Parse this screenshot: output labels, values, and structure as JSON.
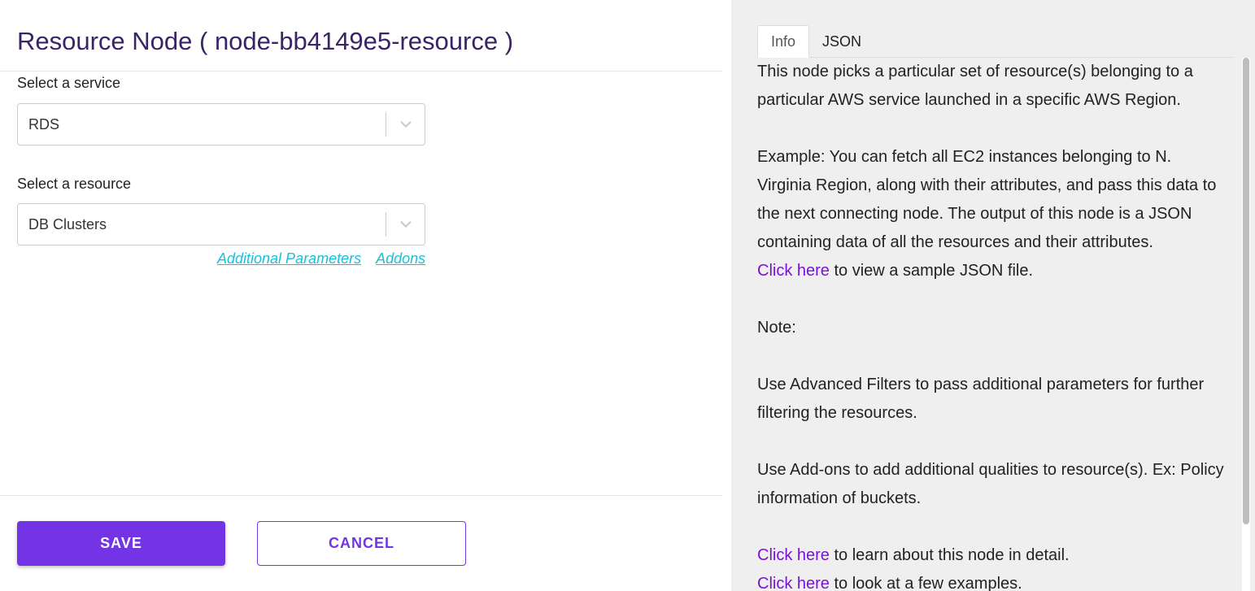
{
  "header": {
    "title": "Resource Node ( node-bb4149e5-resource )"
  },
  "form": {
    "service": {
      "label": "Select a service",
      "value": "RDS"
    },
    "resource": {
      "label": "Select a resource",
      "value": "DB Clusters"
    },
    "links": {
      "additional_parameters": "Additional Parameters",
      "addons": "Addons"
    }
  },
  "actions": {
    "save_label": "SAVE",
    "cancel_label": "CANCEL"
  },
  "panel": {
    "tabs": [
      {
        "label": "Info",
        "active": true
      },
      {
        "label": "JSON",
        "active": false
      }
    ],
    "info": {
      "intro": "This node picks a particular set of resource(s) belonging to a particular AWS service launched in a specific AWS Region.",
      "example": "Example: You can fetch all EC2 instances belonging to N. Virginia Region, along with their attributes, and pass this data to the next connecting node. The output of this node is a JSON containing data of all the resources and their attributes.",
      "sample_link": "Click here",
      "sample_text": " to view a sample JSON file.",
      "note": "Note:",
      "filters": "Use Advanced Filters to pass additional parameters for further filtering the resources.",
      "addons": "Use Add-ons to add additional qualities to resource(s). Ex: Policy information of buckets.",
      "learn_link": "Click here",
      "learn_text": " to learn about this node in detail.",
      "examples_link": "Click here",
      "examples_text": " to look at a few examples."
    }
  },
  "colors": {
    "title": "#3a2466",
    "accent": "#7234e4",
    "link_cyan": "#18c0d8",
    "link_purple": "#7a12d6",
    "panel_bg": "#efefef"
  },
  "icons": {
    "dropdown": "chevron-down-icon"
  }
}
